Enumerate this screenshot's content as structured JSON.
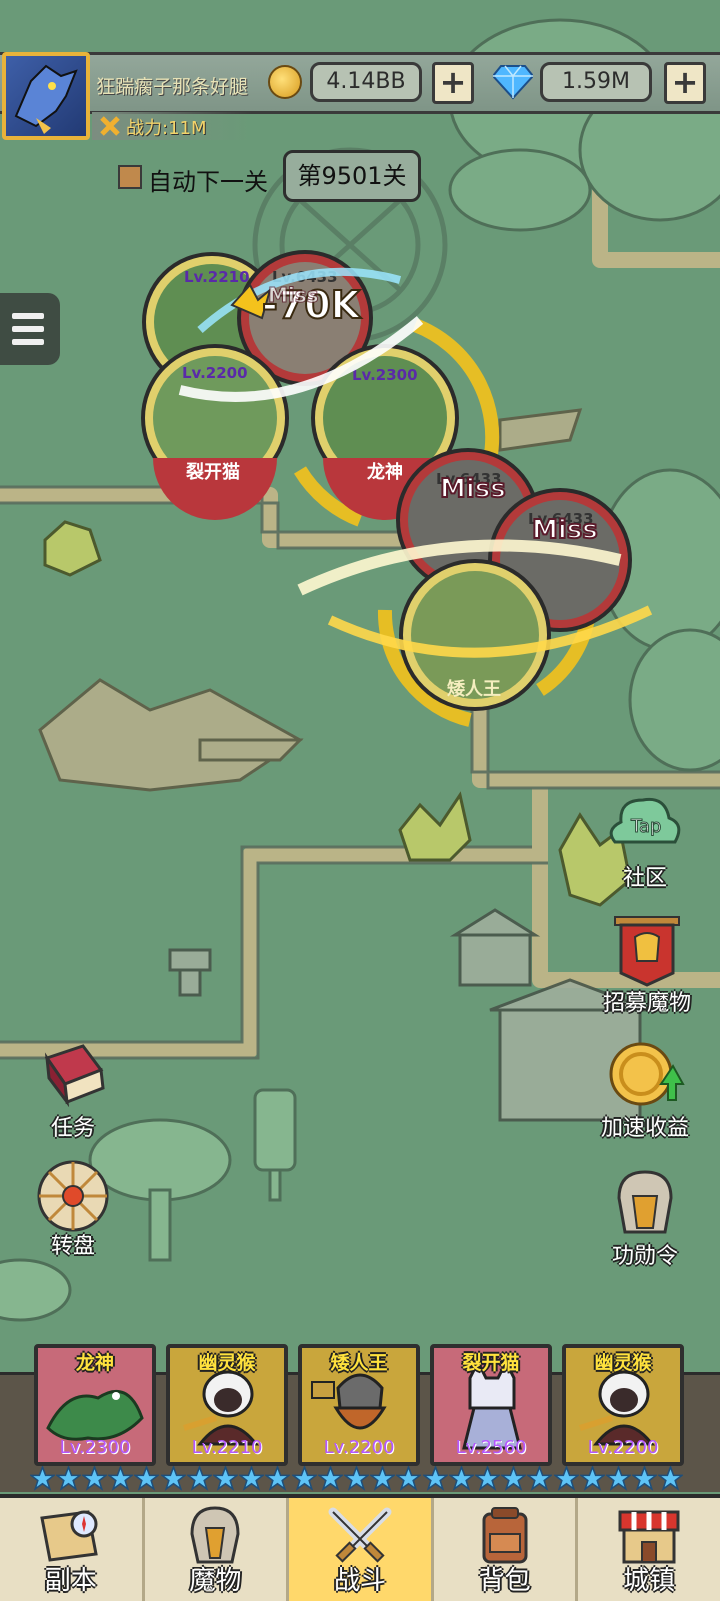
{
  "header": {
    "player_name": "狂踹瘸子那条好腿",
    "gold": "4.14BB",
    "gems": "1.59M",
    "power": "战力:11M",
    "add_gold": "+",
    "add_gems": "+"
  },
  "controls": {
    "auto_next_label": "自动下一关",
    "stage_label": "第9501关"
  },
  "battle": {
    "units": [
      {
        "name": "",
        "level": "Lv.2210"
      },
      {
        "name": "",
        "level": "Lv.6433"
      },
      {
        "name": "裂开猫",
        "level": "Lv.2200"
      },
      {
        "name": "龙神",
        "level": "Lv.2300"
      },
      {
        "name": "",
        "level": "Lv.6433"
      },
      {
        "name": "",
        "level": "Lv.6433"
      },
      {
        "name": "矮人王",
        "level": ""
      }
    ],
    "damage_text": "-70K",
    "miss_text_1": "Miss",
    "miss_text_2": "Miss",
    "miss_text_3": "Miss"
  },
  "side_buttons": {
    "community_tag": "Tap",
    "community": "社区",
    "recruit": "招募魔物",
    "boost": "加速收益",
    "quest": "任务",
    "wheel": "转盘",
    "merit": "功勋令"
  },
  "team": [
    {
      "name": "龙神",
      "level": "Lv.2300",
      "stars": 5,
      "color": "#c76a79"
    },
    {
      "name": "幽灵猴",
      "level": "Lv.2210",
      "stars": 5,
      "color": "#c9a63c"
    },
    {
      "name": "矮人王",
      "level": "Lv.2200",
      "stars": 5,
      "color": "#c9a63c"
    },
    {
      "name": "裂开猫",
      "level": "Lv.2560",
      "stars": 5,
      "color": "#c76a79"
    },
    {
      "name": "幽灵猴",
      "level": "Lv.2200",
      "stars": 5,
      "color": "#c9a63c"
    }
  ],
  "nav": {
    "items": [
      "副本",
      "魔物",
      "战斗",
      "背包",
      "城镇"
    ],
    "active": "战斗"
  },
  "colors": {
    "map_bg": "#6a9a78",
    "accent_gold": "#ffd86b",
    "nav_bg": "#e8dfc4"
  }
}
